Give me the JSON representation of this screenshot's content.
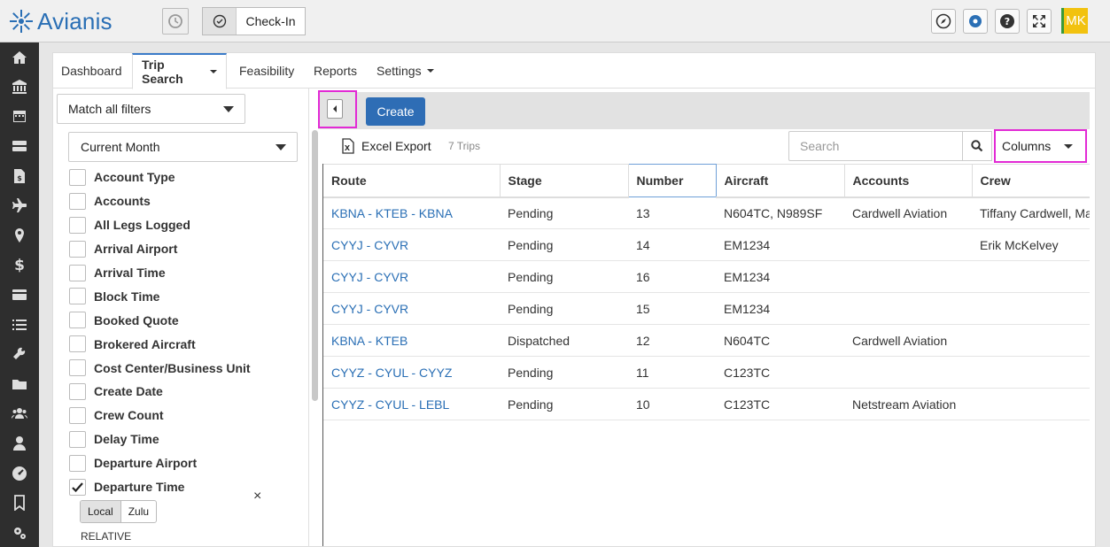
{
  "app": {
    "name": "Avianis",
    "checkin_label": "Check-In",
    "avatar_initials": "MK",
    "brand_color": "#2a6fb5"
  },
  "sidebar": {
    "icons": [
      "home-icon",
      "bank-icon",
      "calendar-icon",
      "server-icon",
      "invoice-icon",
      "plane-icon",
      "map-pin-icon",
      "dollar-icon",
      "credit-card-icon",
      "list-icon",
      "wrench-icon",
      "folder-icon",
      "users-icon",
      "user-icon",
      "gauge-icon",
      "bookmark-icon",
      "gears-icon"
    ]
  },
  "tabs": [
    {
      "label": "Dashboard",
      "active": false,
      "dropdown": false
    },
    {
      "label": "Trip Search",
      "active": true,
      "dropdown": true
    },
    {
      "label": "Feasibility",
      "active": false,
      "dropdown": false
    },
    {
      "label": "Reports",
      "active": false,
      "dropdown": false
    },
    {
      "label": "Settings",
      "active": false,
      "dropdown": true
    }
  ],
  "filters": {
    "match_mode": "Match all filters",
    "period": "Current Month",
    "items": [
      {
        "label": "Account Type",
        "checked": false
      },
      {
        "label": "Accounts",
        "checked": false
      },
      {
        "label": "All Legs Logged",
        "checked": false
      },
      {
        "label": "Arrival Airport",
        "checked": false
      },
      {
        "label": "Arrival Time",
        "checked": false
      },
      {
        "label": "Block Time",
        "checked": false
      },
      {
        "label": "Booked Quote",
        "checked": false
      },
      {
        "label": "Brokered Aircraft",
        "checked": false
      },
      {
        "label": "Cost Center/Business Unit",
        "checked": false
      },
      {
        "label": "Create Date",
        "checked": false
      },
      {
        "label": "Crew Count",
        "checked": false
      },
      {
        "label": "Delay Time",
        "checked": false
      },
      {
        "label": "Departure Airport",
        "checked": false
      },
      {
        "label": "Departure Time",
        "checked": true
      }
    ],
    "time_mode": {
      "local": "Local",
      "zulu": "Zulu"
    },
    "relative_label": "RELATIVE",
    "close_glyph": "×"
  },
  "toolbar": {
    "create_label": "Create",
    "excel_label": "Excel Export",
    "trip_count": "7 Trips",
    "search_placeholder": "Search",
    "columns_label": "Columns"
  },
  "table": {
    "headers": [
      "Route",
      "Stage",
      "Number",
      "Aircraft",
      "Accounts",
      "Crew"
    ],
    "rows": [
      [
        "KBNA - KTEB - KBNA",
        "Pending",
        "13",
        "N604TC, N989SF",
        "Cardwell Aviation",
        "Tiffany Cardwell, Ma"
      ],
      [
        "CYYJ - CYVR",
        "Pending",
        "14",
        "EM1234",
        "",
        "Erik McKelvey"
      ],
      [
        "CYYJ - CYVR",
        "Pending",
        "16",
        "EM1234",
        "",
        ""
      ],
      [
        "CYYJ - CYVR",
        "Pending",
        "15",
        "EM1234",
        "",
        ""
      ],
      [
        "KBNA - KTEB",
        "Dispatched",
        "12",
        "N604TC",
        "Cardwell Aviation",
        ""
      ],
      [
        "CYYZ - CYUL - CYYZ",
        "Pending",
        "11",
        "C123TC",
        "",
        ""
      ],
      [
        "CYYZ - CYUL - LEBL",
        "Pending",
        "10",
        "C123TC",
        "Netstream Aviation",
        ""
      ]
    ]
  }
}
